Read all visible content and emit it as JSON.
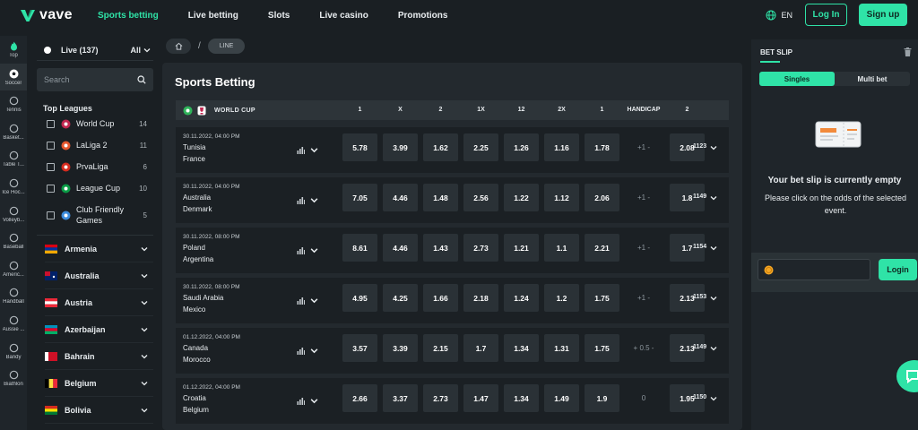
{
  "brand": {
    "name": "vave",
    "accent": "#2fe3a7"
  },
  "nav": {
    "links": [
      "Sports betting",
      "Live betting",
      "Slots",
      "Live casino",
      "Promotions"
    ],
    "active_index": 0,
    "lang": "EN",
    "login_label": "Log In",
    "signup_label": "Sign up"
  },
  "sports": [
    {
      "label": "Top",
      "icon": "fire-icon"
    },
    {
      "label": "Soccer",
      "icon": "soccer-ball-icon"
    },
    {
      "label": "Tennis",
      "icon": "tennis-ball-icon"
    },
    {
      "label": "Basket...",
      "icon": "basketball-icon"
    },
    {
      "label": "Table T...",
      "icon": "table-tennis-icon"
    },
    {
      "label": "Ice Hoc...",
      "icon": "ice-hockey-icon"
    },
    {
      "label": "Volleyb...",
      "icon": "volleyball-icon"
    },
    {
      "label": "Baseball",
      "icon": "baseball-icon"
    },
    {
      "label": "Americ...",
      "icon": "american-football-icon"
    },
    {
      "label": "Handball",
      "icon": "handball-icon"
    },
    {
      "label": "Aussie ...",
      "icon": "aussie-rules-icon"
    },
    {
      "label": "Bandy",
      "icon": "bandy-icon"
    },
    {
      "label": "Biathlon",
      "icon": "biathlon-icon"
    }
  ],
  "sports_active_index": 1,
  "left": {
    "live_label": "Live (137)",
    "all_label": "All",
    "search_placeholder": "Search",
    "top_leagues_title": "Top Leagues",
    "leagues": [
      {
        "name": "World Cup",
        "count": "14"
      },
      {
        "name": "LaLiga 2",
        "count": "11"
      },
      {
        "name": "PrvaLiga",
        "count": "6"
      },
      {
        "name": "League Cup",
        "count": "10"
      },
      {
        "name": "Club Friendly Games",
        "count": "5"
      }
    ],
    "countries": [
      "Armenia",
      "Australia",
      "Austria",
      "Azerbaijan",
      "Bahrain",
      "Belgium",
      "Bolivia"
    ]
  },
  "breadcrumbs": {
    "line": "LINE"
  },
  "main": {
    "title": "Sports Betting",
    "league_title": "WORLD CUP",
    "columns": [
      "1",
      "X",
      "2",
      "1X",
      "12",
      "2X",
      "1",
      "HANDICAP",
      "2"
    ]
  },
  "matches": [
    {
      "date": "30.11.2022, 04:00 PM",
      "team1": "Tunisia",
      "team2": "France",
      "odds": [
        "5.78",
        "3.99",
        "1.62",
        "2.25",
        "1.26",
        "1.16",
        "1.78"
      ],
      "handicap": "+1 -",
      "odd2": "2.08",
      "more": "1123"
    },
    {
      "date": "30.11.2022, 04:00 PM",
      "team1": "Australia",
      "team2": "Denmark",
      "odds": [
        "7.05",
        "4.46",
        "1.48",
        "2.56",
        "1.22",
        "1.12",
        "2.06"
      ],
      "handicap": "+1 -",
      "odd2": "1.8",
      "more": "1149"
    },
    {
      "date": "30.11.2022, 08:00 PM",
      "team1": "Poland",
      "team2": "Argentina",
      "odds": [
        "8.61",
        "4.46",
        "1.43",
        "2.73",
        "1.21",
        "1.1",
        "2.21"
      ],
      "handicap": "+1 -",
      "odd2": "1.7",
      "more": "1154"
    },
    {
      "date": "30.11.2022, 08:00 PM",
      "team1": "Saudi Arabia",
      "team2": "Mexico",
      "odds": [
        "4.95",
        "4.25",
        "1.66",
        "2.18",
        "1.24",
        "1.2",
        "1.75"
      ],
      "handicap": "+1 -",
      "odd2": "2.13",
      "more": "1153"
    },
    {
      "date": "01.12.2022, 04:00 PM",
      "team1": "Canada",
      "team2": "Morocco",
      "odds": [
        "3.57",
        "3.39",
        "2.15",
        "1.7",
        "1.34",
        "1.31",
        "1.75"
      ],
      "handicap": "+ 0.5 -",
      "odd2": "2.13",
      "more": "1149"
    },
    {
      "date": "01.12.2022, 04:00 PM",
      "team1": "Croatia",
      "team2": "Belgium",
      "odds": [
        "2.66",
        "3.37",
        "2.73",
        "1.47",
        "1.34",
        "1.49",
        "1.9"
      ],
      "handicap": "0",
      "odd2": "1.95",
      "more": "1150"
    }
  ],
  "betslip": {
    "title": "BET SLIP",
    "tabs": [
      "Singles",
      "Multi bet"
    ],
    "active_tab": 0,
    "empty_title": "Your bet slip is currently empty",
    "empty_sub": "Please click on the odds of the selected event.",
    "login_label": "Login"
  }
}
